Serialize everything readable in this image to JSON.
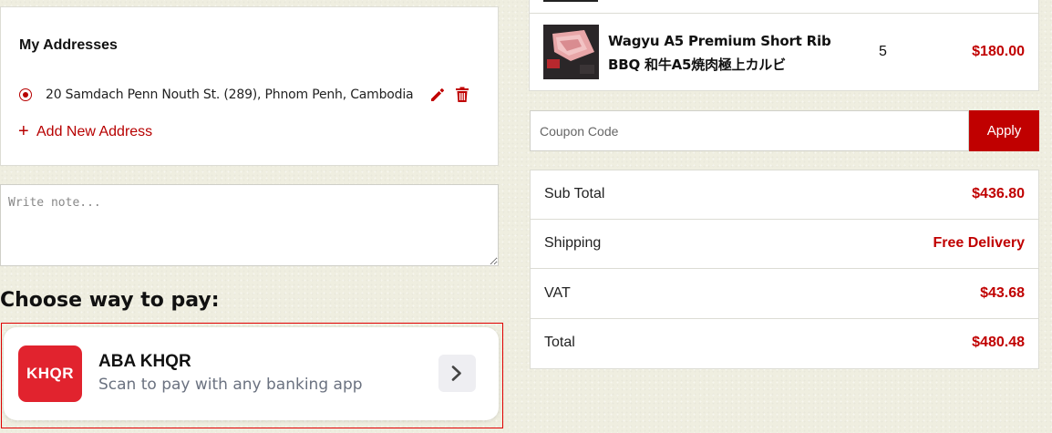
{
  "addresses": {
    "title": "My Addresses",
    "items": [
      {
        "text": "20 Samdach Penn Nouth St. (289), Phnom Penh, Cambodia",
        "selected": true
      }
    ],
    "add_label": "Add New Address"
  },
  "note": {
    "placeholder": "Write note..."
  },
  "payment": {
    "title": "Choose way to pay:",
    "method": {
      "logo_text": "KHQR",
      "name": "ABA KHQR",
      "description": "Scan to pay with any banking app"
    }
  },
  "cart": {
    "items": [
      {
        "name": "Wagyu A5 Premium Short Rib BBQ 和牛A5焼肉極上カルビ",
        "quantity": "5",
        "price": "$180.00"
      }
    ]
  },
  "coupon": {
    "placeholder": "Coupon Code",
    "apply_label": "Apply"
  },
  "summary": {
    "rows": [
      {
        "label": "Sub Total",
        "value": "$436.80"
      },
      {
        "label": "Shipping",
        "value": "Free Delivery"
      },
      {
        "label": "VAT",
        "value": "$43.68"
      },
      {
        "label": "Total",
        "value": "$480.48"
      }
    ]
  },
  "colors": {
    "accent": "#c00000",
    "khqr_red": "#e1232e",
    "background": "#efeee0"
  },
  "icons": [
    "pencil-icon",
    "trash-icon",
    "plus-icon",
    "chevron-right-icon"
  ]
}
